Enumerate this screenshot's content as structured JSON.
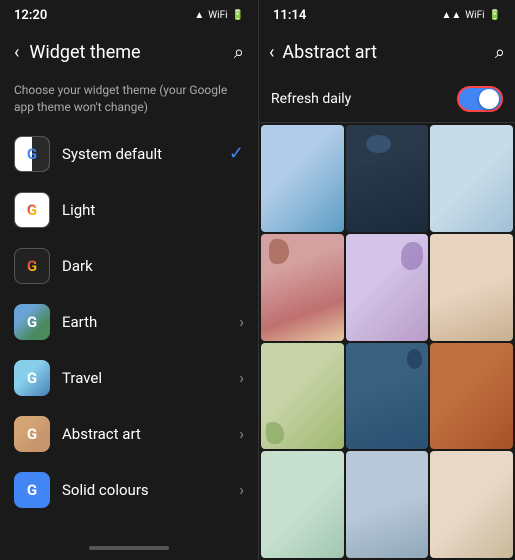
{
  "left_panel": {
    "status_bar": {
      "time": "12:20",
      "icons": [
        "wifi",
        "signal",
        "battery"
      ]
    },
    "header": {
      "title": "Widget theme",
      "back_label": "‹",
      "search_label": "⌕"
    },
    "subtitle": "Choose your widget theme (your Google app theme won't change)",
    "menu_items": [
      {
        "id": "system_default",
        "label": "System default",
        "has_check": true,
        "has_chevron": false
      },
      {
        "id": "light",
        "label": "Light",
        "has_check": false,
        "has_chevron": false
      },
      {
        "id": "dark",
        "label": "Dark",
        "has_check": false,
        "has_chevron": false
      },
      {
        "id": "earth",
        "label": "Earth",
        "has_check": false,
        "has_chevron": true
      },
      {
        "id": "travel",
        "label": "Travel",
        "has_check": false,
        "has_chevron": true
      },
      {
        "id": "abstract_art",
        "label": "Abstract art",
        "has_check": false,
        "has_chevron": true
      },
      {
        "id": "solid_colours",
        "label": "Solid colours",
        "has_check": false,
        "has_chevron": true
      }
    ]
  },
  "right_panel": {
    "status_bar": {
      "time": "11:14",
      "icons": [
        "signal",
        "wifi",
        "battery"
      ]
    },
    "header": {
      "title": "Abstract art",
      "back_label": "‹",
      "search_label": "⌕"
    },
    "refresh_row": {
      "label": "Refresh daily",
      "toggle_on": true
    },
    "grid_patches": [
      "patch-1",
      "patch-2",
      "patch-3",
      "patch-4",
      "patch-5",
      "patch-6",
      "patch-7",
      "patch-8",
      "patch-9",
      "patch-10",
      "patch-11",
      "patch-12"
    ]
  }
}
